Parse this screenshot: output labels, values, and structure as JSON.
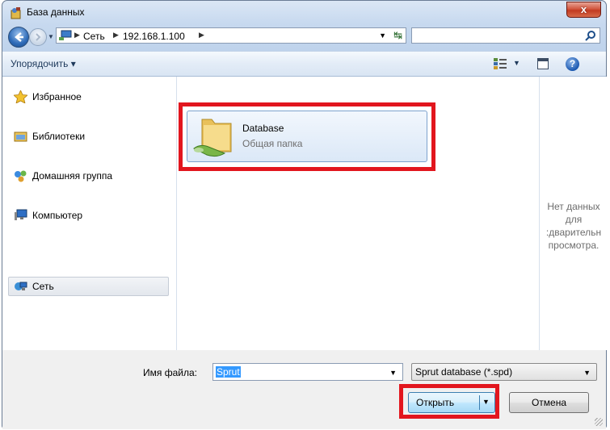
{
  "window": {
    "title": "База данных",
    "close_symbol": "x"
  },
  "navigation": {
    "breadcrumbs": [
      "Сеть",
      "192.168.1.100"
    ],
    "search_placeholder": ""
  },
  "toolbar": {
    "organize_label": "Упорядочить ▾",
    "help_symbol": "?"
  },
  "sidebar": {
    "items": [
      {
        "label": "Избранное",
        "icon": "star-icon"
      },
      {
        "label": "Библиотеки",
        "icon": "library-icon"
      },
      {
        "label": "Домашняя группа",
        "icon": "homegroup-icon"
      },
      {
        "label": "Компьютер",
        "icon": "computer-icon"
      },
      {
        "label": "Сеть",
        "icon": "network-icon",
        "selected": true
      }
    ]
  },
  "content": {
    "items": [
      {
        "name": "Database",
        "subtitle": "Общая папка",
        "icon": "shared-folder-icon"
      }
    ]
  },
  "preview": {
    "lines": [
      "Нет данных",
      "для",
      ":дварительн",
      "просмотра."
    ]
  },
  "footer": {
    "filename_label": "Имя файла:",
    "filename_value": "Sprut",
    "filetype_value": "Sprut database (*.spd)",
    "open_label": "Открыть",
    "cancel_label": "Отмена"
  },
  "colors": {
    "highlight_box": "#e2161e",
    "selection": "#3399ff"
  }
}
